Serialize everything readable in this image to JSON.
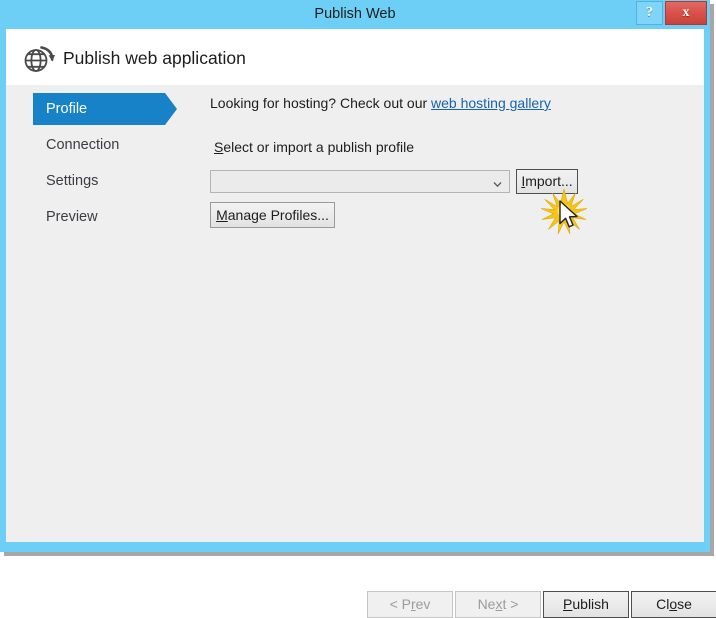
{
  "window": {
    "title": "Publish Web",
    "help_label": "?",
    "close_label": "x",
    "accent_blue": "#6dcff6",
    "close_red": "#d9534c"
  },
  "header": {
    "title": "Publish web application",
    "icon": "globe-publish-icon"
  },
  "sidebar": {
    "active_color": "#1782c8",
    "items": [
      {
        "label": "Profile",
        "active": true
      },
      {
        "label": "Connection",
        "active": false
      },
      {
        "label": "Settings",
        "active": false
      },
      {
        "label": "Preview",
        "active": false
      }
    ]
  },
  "content": {
    "hosting_prompt": "Looking for hosting? Check out our ",
    "hosting_link": "web hosting gallery",
    "hosting_link_color": "#1763b0",
    "profile_label_prefix": "S",
    "profile_label_rest": "elect or import a publish profile",
    "profile_combo_value": "",
    "profile_combo_placeholder": "",
    "import_button_prefix": "I",
    "import_button_rest": "mport...",
    "manage_button_prefix": "M",
    "manage_button_rest": "anage Profiles..."
  },
  "footer": {
    "prev": {
      "pre": "< P",
      "key": "r",
      "post": "ev",
      "disabled": true
    },
    "next": {
      "pre": "Ne",
      "key": "x",
      "post": "t >",
      "disabled": true
    },
    "publish": {
      "pre": "",
      "key": "P",
      "post": "ublish",
      "disabled": false
    },
    "close": {
      "pre": "Cl",
      "key": "o",
      "post": "se",
      "disabled": false
    }
  },
  "pointer": {
    "cursor_name": "mouse-pointer",
    "click_effect": "click-burst"
  }
}
